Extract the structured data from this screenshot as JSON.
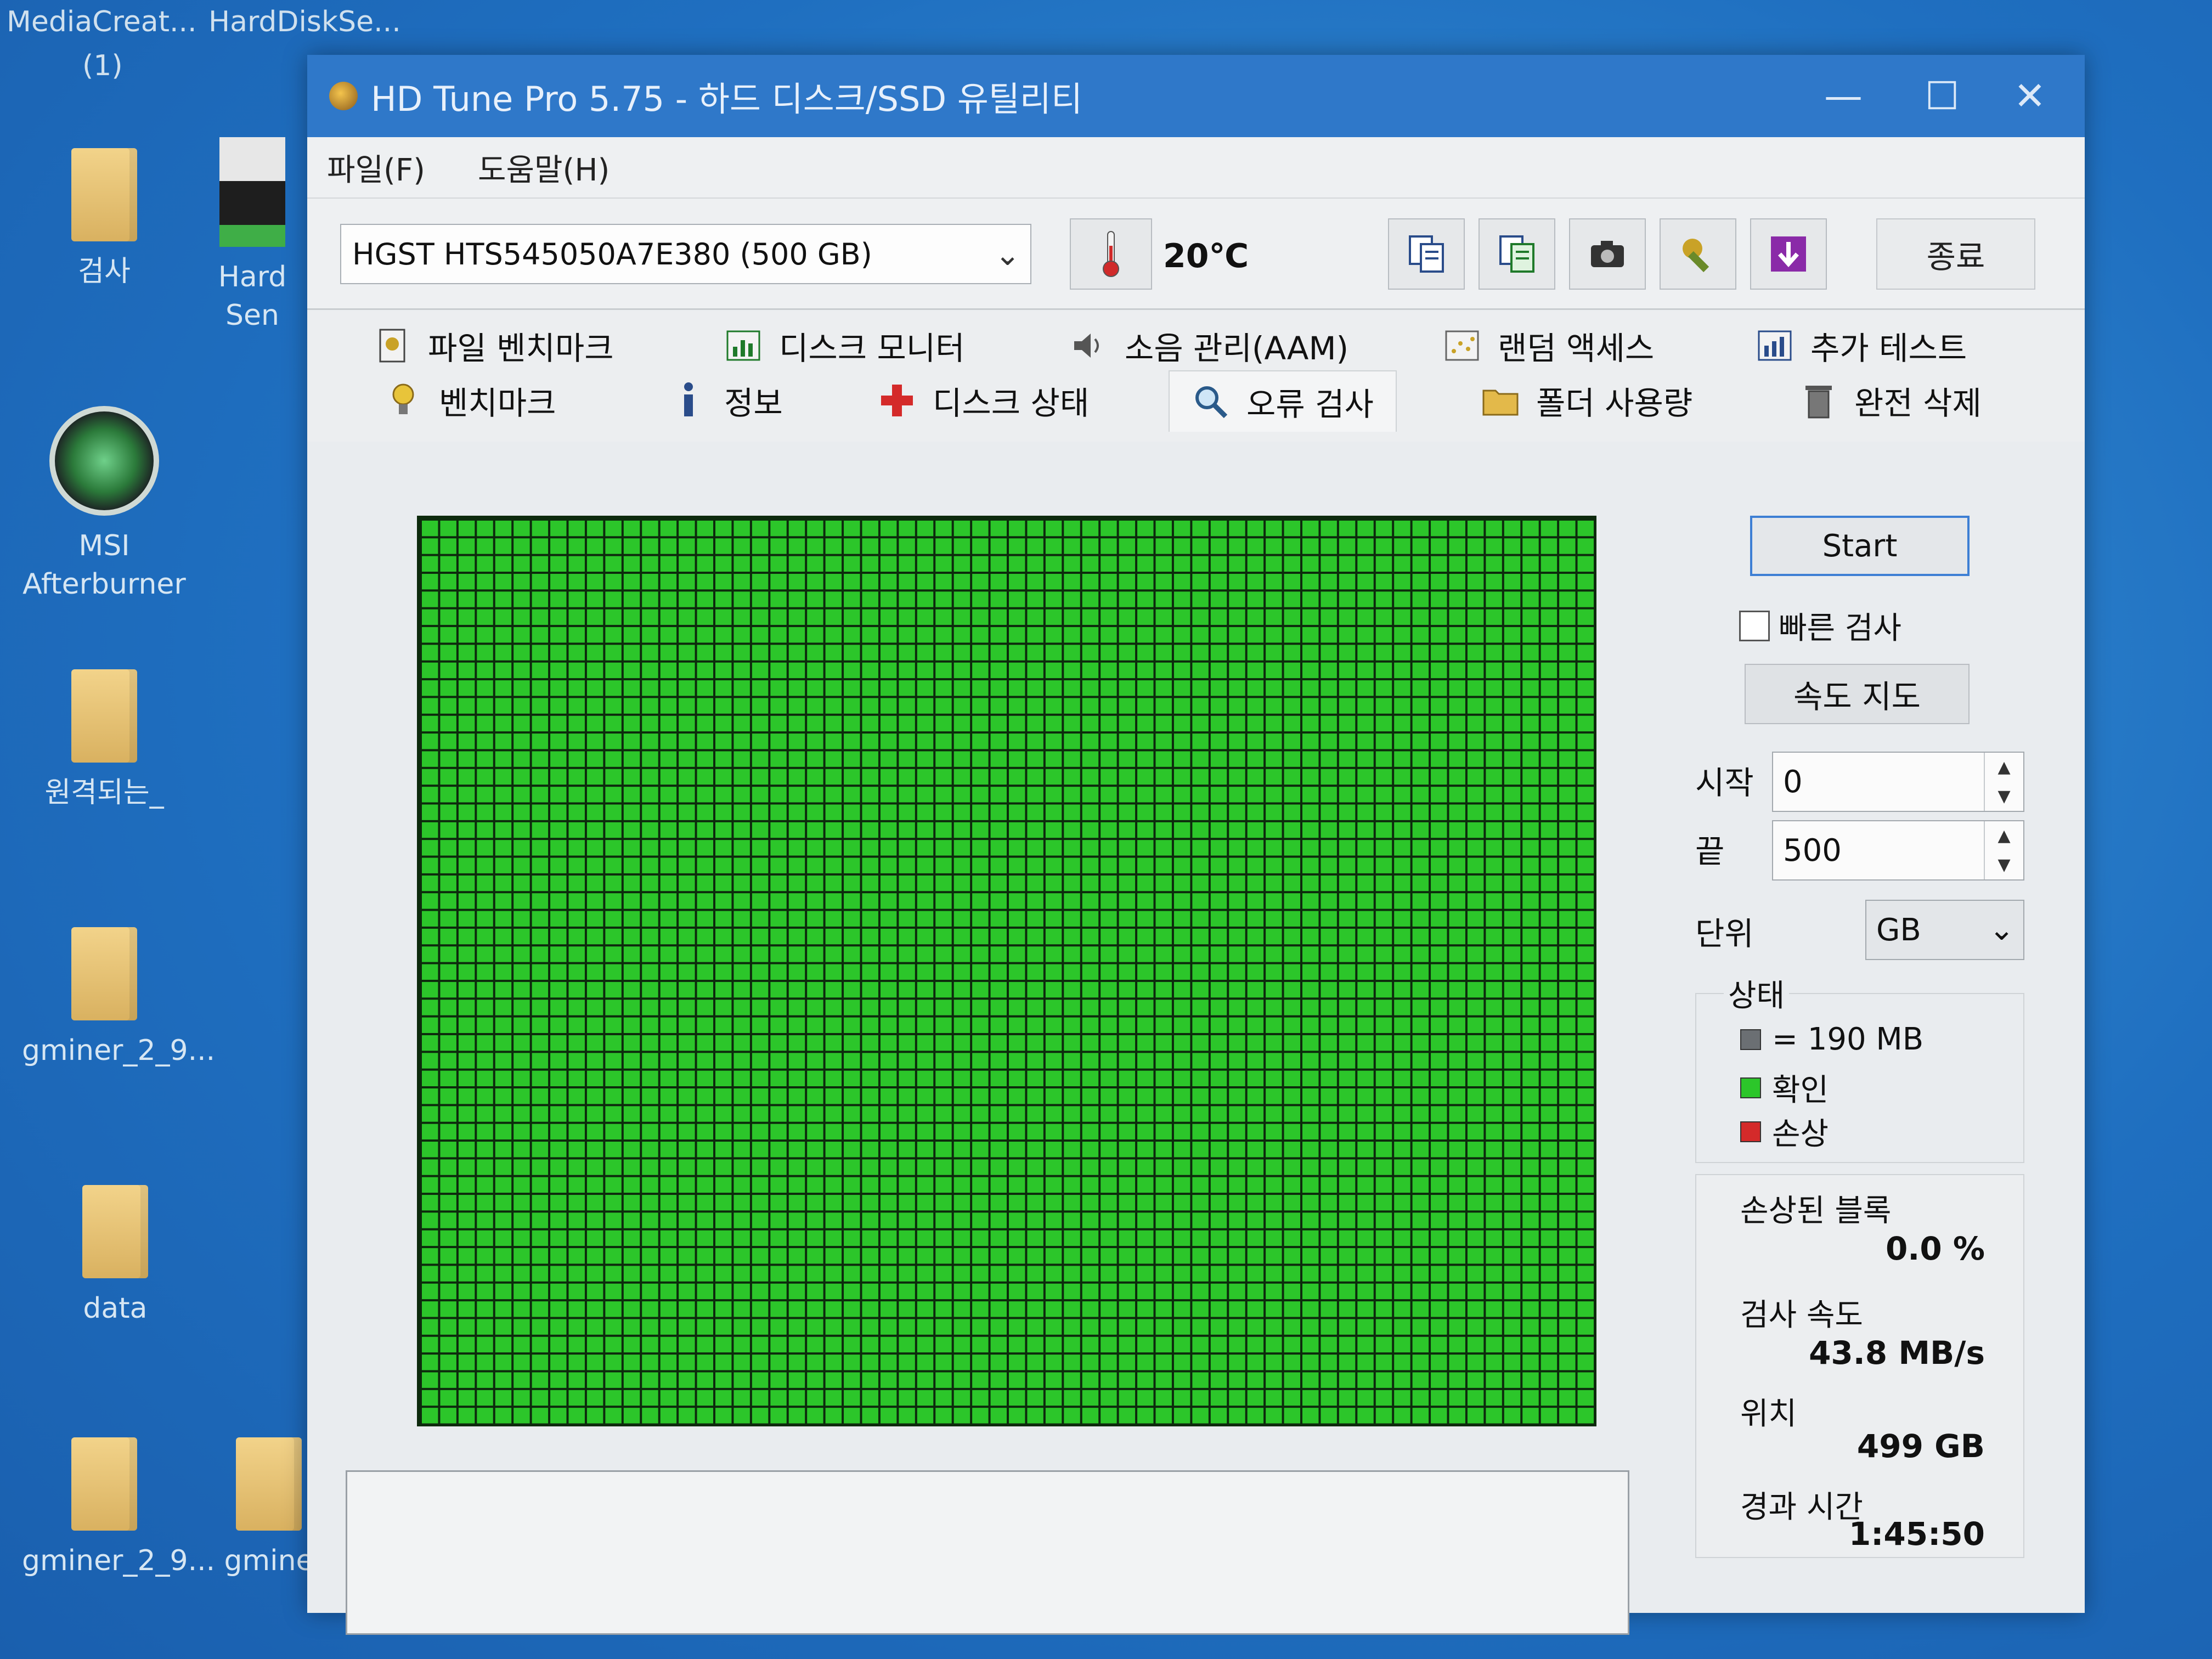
{
  "desktop": {
    "top_labels": [
      "MediaCreat...",
      "(1)",
      "HardDiskSe..."
    ],
    "icons": [
      {
        "label": "검사"
      },
      {
        "label": "Hard Sen"
      },
      {
        "label": "MSI Afterburner"
      },
      {
        "label": "원격되는_"
      },
      {
        "label": "gminer_2_9..."
      },
      {
        "label": "data"
      },
      {
        "label": "gminer_2_9..."
      },
      {
        "label": "gmine"
      }
    ]
  },
  "window": {
    "title": "HD Tune Pro 5.75 - 하드 디스크/SSD 유틸리티",
    "controls": {
      "minimize": "—",
      "maximize": "☐",
      "close": "✕"
    }
  },
  "menu": [
    "파일(F)",
    "도움말(H)"
  ],
  "toolbar": {
    "drive": "HGST HTS545050A7E380 (500 GB)",
    "temperature": "20℃",
    "exit_label": "종료"
  },
  "tabs": {
    "row1": [
      "파일 벤치마크",
      "디스크 모니터",
      "소음 관리(AAM)",
      "랜덤 액세스",
      "추가 테스트"
    ],
    "row2": [
      "벤치마크",
      "정보",
      "디스크 상태",
      "오류 검사",
      "폴더 사용량",
      "완전 삭제"
    ],
    "active": "오류 검사"
  },
  "error_scan": {
    "start_label": "Start",
    "quick_scan_label": "빠른 검사",
    "quick_scan_checked": false,
    "speed_map_label": "속도 지도",
    "start_field_label": "시작",
    "start_value": "0",
    "end_field_label": "끝",
    "end_value": "500",
    "unit_label": "단위",
    "unit_value": "GB",
    "legend": {
      "title": "상태",
      "items": [
        {
          "label": "= 190 MB",
          "color": "#6b6f73"
        },
        {
          "label": "확인",
          "color": "#2cc62a"
        },
        {
          "label": "손상",
          "color": "#d42a2a"
        }
      ]
    },
    "stats": {
      "damaged_label": "손상된 블록",
      "damaged_value": "0.0 %",
      "speed_label": "검사 속도",
      "speed_value": "43.8 MB/s",
      "position_label": "위치",
      "position_value": "499 GB",
      "elapsed_label": "경과 시간",
      "elapsed_value": "1:45:50"
    },
    "block_grid": {
      "columns": 64,
      "rows": 51,
      "ok_color": "#2cc62a",
      "damaged_blocks": 0
    }
  },
  "colors": {
    "titlebar": "#2f78c9",
    "desktop": "#1f6fc0",
    "ok_block": "#2cc62a",
    "accent_border": "#3d7fd4"
  }
}
